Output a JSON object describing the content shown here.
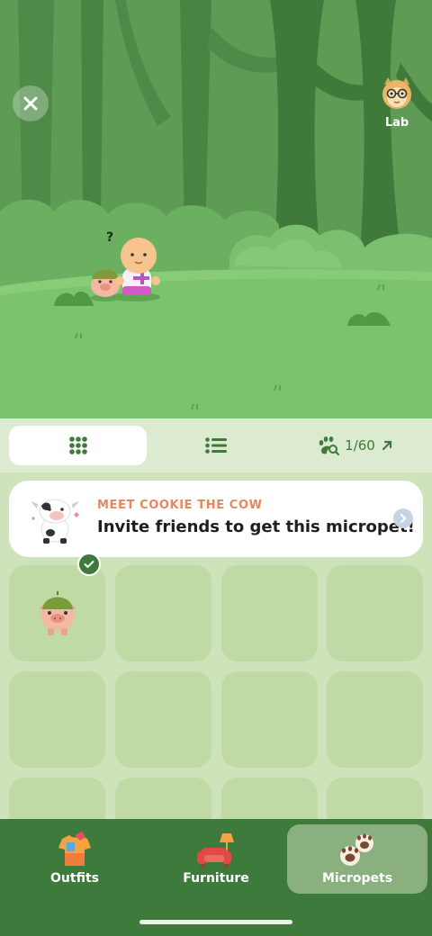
{
  "header": {
    "close_icon": "close-icon",
    "lab_label": "Lab"
  },
  "toolbar": {
    "grid_icon": "grid-icon",
    "list_icon": "list-icon",
    "count_icon": "paw-search-icon",
    "count_text": "1/60",
    "count_arrow_icon": "arrow-up-right-icon"
  },
  "banner": {
    "title": "MEET COOKIE THE COW",
    "subtitle": "Invite friends to get this micropet!",
    "arrow_icon": "chevron-right-icon"
  },
  "grid": {
    "cells": [
      {
        "pet": "pig",
        "selected": true
      },
      {
        "pet": null
      },
      {
        "pet": null
      },
      {
        "pet": null
      },
      {
        "pet": null
      },
      {
        "pet": null
      },
      {
        "pet": null
      },
      {
        "pet": null
      },
      {
        "pet": null
      },
      {
        "pet": null
      },
      {
        "pet": null
      },
      {
        "pet": null
      }
    ]
  },
  "bottom_nav": {
    "items": [
      {
        "label": "Outfits",
        "icon": "outfits-icon",
        "active": false
      },
      {
        "label": "Furniture",
        "icon": "furniture-icon",
        "active": false
      },
      {
        "label": "Micropets",
        "icon": "paws-icon",
        "active": true
      }
    ]
  },
  "colors": {
    "accent": "#3d7a3c",
    "banner_title": "#e4875f",
    "grass": "#7cc46c",
    "panel": "#cfe3bb"
  }
}
